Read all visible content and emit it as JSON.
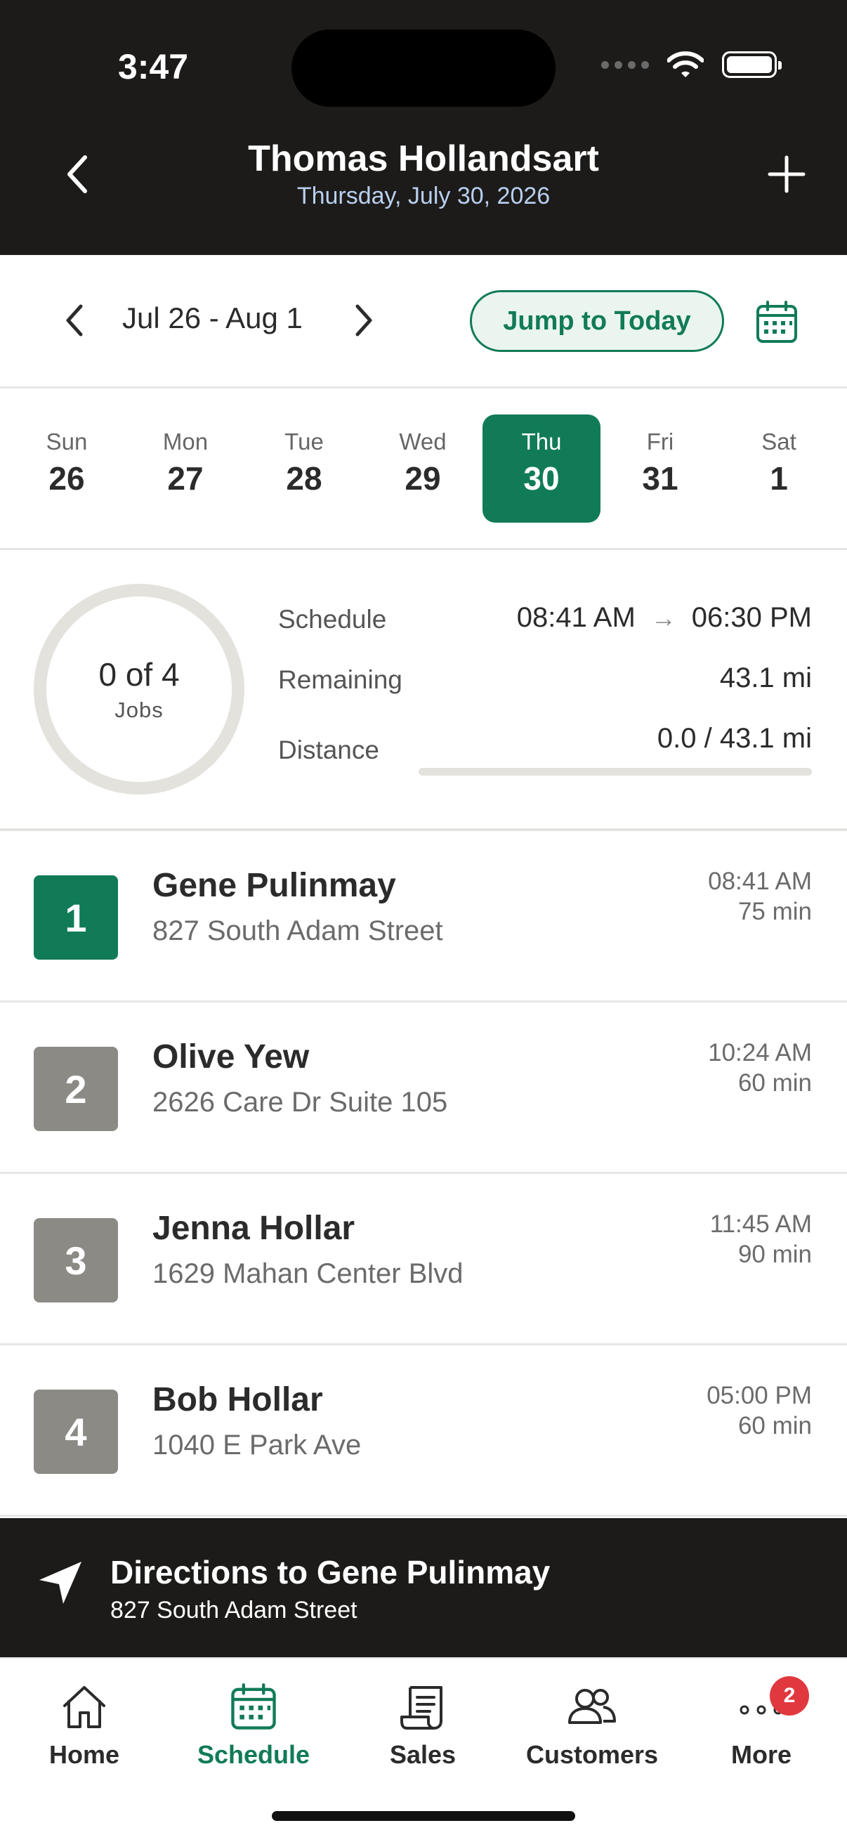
{
  "status_bar": {
    "time": "3:47"
  },
  "header": {
    "title": "Thomas Hollandsart",
    "date": "Thursday, July 30, 2026"
  },
  "week_nav": {
    "range": "Jul 26 - Aug 1",
    "jump_label": "Jump to Today"
  },
  "days": [
    {
      "name": "Sun",
      "num": "26"
    },
    {
      "name": "Mon",
      "num": "27"
    },
    {
      "name": "Tue",
      "num": "28"
    },
    {
      "name": "Wed",
      "num": "29"
    },
    {
      "name": "Thu",
      "num": "30"
    },
    {
      "name": "Fri",
      "num": "31"
    },
    {
      "name": "Sat",
      "num": "1"
    }
  ],
  "selected_day_index": 4,
  "summary": {
    "jobs_count": "0 of 4",
    "jobs_label": "Jobs",
    "schedule_label": "Schedule",
    "schedule_start": "08:41 AM",
    "schedule_end": "06:30 PM",
    "remaining_label": "Remaining",
    "remaining_value": "43.1 mi",
    "distance_label": "Distance",
    "distance_value": "0.0 / 43.1 mi",
    "distance_progress": 0
  },
  "jobs": [
    {
      "num": "1",
      "name": "Gene Pulinmay",
      "address": "827 South Adam Street",
      "time": "08:41 AM",
      "duration": "75 min",
      "color": "#117b57"
    },
    {
      "num": "2",
      "name": "Olive Yew",
      "address": "2626 Care Dr Suite 105",
      "time": "10:24 AM",
      "duration": "60 min",
      "color": "#8c8a84"
    },
    {
      "num": "3",
      "name": "Jenna Hollar",
      "address": "1629 Mahan Center Blvd",
      "time": "11:45 AM",
      "duration": "90 min",
      "color": "#8c8a84"
    },
    {
      "num": "4",
      "name": "Bob Hollar",
      "address": "1040 E Park Ave",
      "time": "05:00 PM",
      "duration": "60 min",
      "color": "#8c8a84"
    }
  ],
  "directions": {
    "title": "Directions to Gene Pulinmay",
    "address": "827 South Adam Street"
  },
  "tabs": {
    "home": "Home",
    "schedule": "Schedule",
    "sales": "Sales",
    "customers": "Customers",
    "more": "More",
    "more_badge": "2"
  },
  "colors": {
    "accent": "#117b57",
    "header_bg": "#1c1b19",
    "badge": "#e0383e"
  }
}
